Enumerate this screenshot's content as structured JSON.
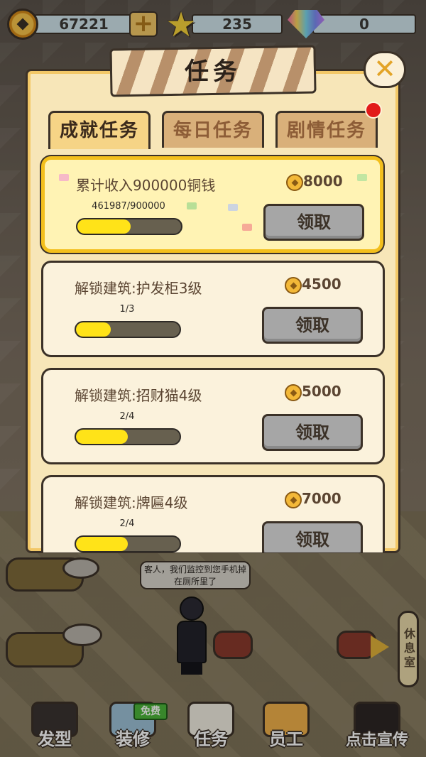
{
  "resources": {
    "coins": "67221",
    "stars": "235",
    "gems": "0",
    "icons": {
      "coin": "coin-icon",
      "add": "plus-icon",
      "star": "star-icon",
      "gem": "diamond-icon"
    }
  },
  "dialog": {
    "title": "任务",
    "close_icon": "close-icon",
    "tabs": [
      {
        "label": "成就任务",
        "active": true
      },
      {
        "label": "每日任务",
        "active": false
      },
      {
        "label": "剧情任务",
        "active": false,
        "has_notification": true
      }
    ],
    "tasks": [
      {
        "name": "累计收入900000铜钱",
        "reward": "8000",
        "progress": "461987/900000",
        "fraction": 0.513,
        "claim_label": "领取",
        "highlighted": true
      },
      {
        "name": "解锁建筑:护发柜3级",
        "reward": "4500",
        "progress": "1/3",
        "fraction": 0.333,
        "claim_label": "领取",
        "highlighted": false
      },
      {
        "name": "解锁建筑:招财猫4级",
        "reward": "5000",
        "progress": "2/4",
        "fraction": 0.5,
        "claim_label": "领取",
        "highlighted": false
      },
      {
        "name": "解锁建筑:牌匾4级",
        "reward": "7000",
        "progress": "2/4",
        "fraction": 0.5,
        "claim_label": "领取",
        "highlighted": false
      }
    ]
  },
  "scene": {
    "speech_bubble": "客人，我们监控到您手机掉在厕所里了",
    "side_sign": "休息室"
  },
  "bottom_nav": {
    "items": [
      {
        "label": "发型"
      },
      {
        "label": "装修",
        "badge": "免费"
      },
      {
        "label": "任务"
      },
      {
        "label": "员工"
      },
      {
        "label": "点击宣传"
      }
    ]
  },
  "colors": {
    "outline": "#3b3127",
    "panel": "#f7e6b8",
    "progress_fill": "#ffe318",
    "highlight_border": "#f3bf1c",
    "claim_button": "#a6a6a6",
    "notification": "#e21a1a"
  }
}
